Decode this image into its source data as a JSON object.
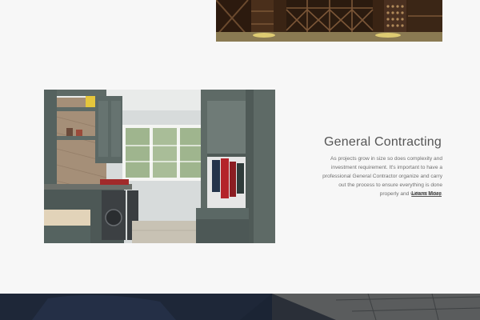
{
  "colors": {
    "page_background": "#f7f7f7",
    "title": "#555555",
    "body_text": "#6f6f6f",
    "link": "#555555",
    "cabinet_green": "#5e6a66",
    "bottom_band": "#1a2230"
  },
  "gallery": {
    "top_image_name": "wine-cellar-photo",
    "section_image_name": "laundry-mudroom-photo",
    "bottom_image_name": "bottom-banner-photo"
  },
  "section": {
    "title": "General Contracting",
    "body": "As projects grow in size so does complexity and investment requirement. It's important to have a professional General Contractor organize and carry out the process to ensure everything is done properly and without delay.",
    "link_label": "Learn More"
  }
}
